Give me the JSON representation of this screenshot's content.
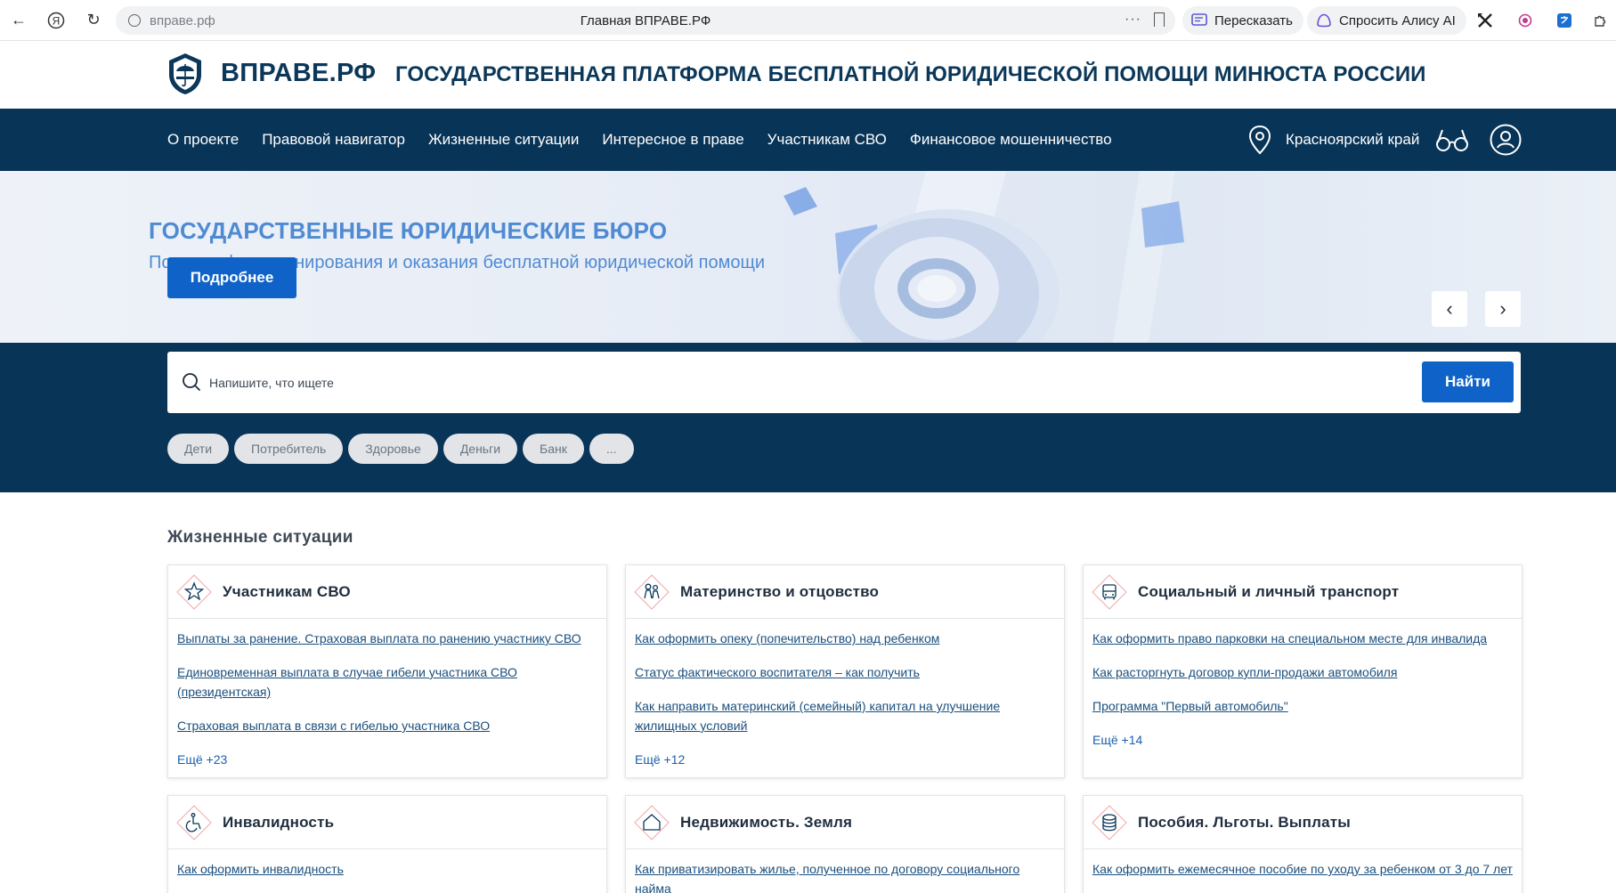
{
  "browser": {
    "url": "вправе.рф",
    "page_title": "Главная ВПРАВЕ.РФ",
    "retell_label": "Пересказать",
    "ask_alice_label": "Спросить Алису AI"
  },
  "site": {
    "brand": "ВПРАВЕ.РФ",
    "tagline": "ГОСУДАРСТВЕННАЯ ПЛАТФОРМА БЕСПЛАТНОЙ ЮРИДИЧЕСКОЙ ПОМОЩИ МИНЮСТА РОССИИ"
  },
  "nav": {
    "items": [
      "О проекте",
      "Правовой навигатор",
      "Жизненные ситуации",
      "Интересное в праве",
      "Участникам СВО",
      "Финансовое мошенничество"
    ],
    "region": "Красноярский край"
  },
  "hero": {
    "title": "ГОСУДАРСТВЕННЫЕ ЮРИДИЧЕСКИЕ БЮРО",
    "subtitle": "Порядок функционирования и оказания бесплатной юридической помощи",
    "button_label": "Подробнее"
  },
  "search": {
    "placeholder": "Напишите, что ищете",
    "button_label": "Найти",
    "tags": [
      "Дети",
      "Потребитель",
      "Здоровье",
      "Деньги",
      "Банк",
      "..."
    ]
  },
  "life_situations": {
    "title": "Жизненные ситуации",
    "cards": [
      {
        "title": "Участникам СВО",
        "icon": "star-icon",
        "links": [
          "Выплаты за ранение. Страховая выплата по ранению участнику СВО",
          "Единовременная выплата в случае гибели участника СВО (президентская)",
          "Страховая выплата в связи с гибелью участника СВО"
        ],
        "more": "Ещё +23"
      },
      {
        "title": "Материнство и отцовство",
        "icon": "family-icon",
        "links": [
          "Как оформить опеку (попечительство) над ребенком",
          "Статус фактического воспитателя – как получить",
          "Как направить материнский (семейный) капитал на улучшение жилищных условий"
        ],
        "more": "Ещё +12"
      },
      {
        "title": "Социальный и личный транспорт",
        "icon": "bus-icon",
        "links": [
          "Как оформить право парковки на специальном месте для инвалида",
          "Как расторгнуть договор купли-продажи автомобиля",
          "Программа \"Первый автомобиль\""
        ],
        "more": "Ещё +14"
      },
      {
        "title": "Инвалидность",
        "icon": "wheelchair-icon",
        "links": [
          "Как оформить инвалидность"
        ],
        "more": ""
      },
      {
        "title": "Недвижимость. Земля",
        "icon": "house-icon",
        "links": [
          "Как приватизировать жилье, полученное по договору социального найма"
        ],
        "more": ""
      },
      {
        "title": "Пособия. Льготы. Выплаты",
        "icon": "coins-icon",
        "links": [
          "Как оформить ежемесячное пособие по уходу за ребенком от 3 до 7 лет"
        ],
        "more": ""
      }
    ]
  },
  "colors": {
    "nav_bg": "#083457",
    "accent": "#0f62c8",
    "brand_text": "#0b3759",
    "hero_text": "#4f8ad3"
  }
}
